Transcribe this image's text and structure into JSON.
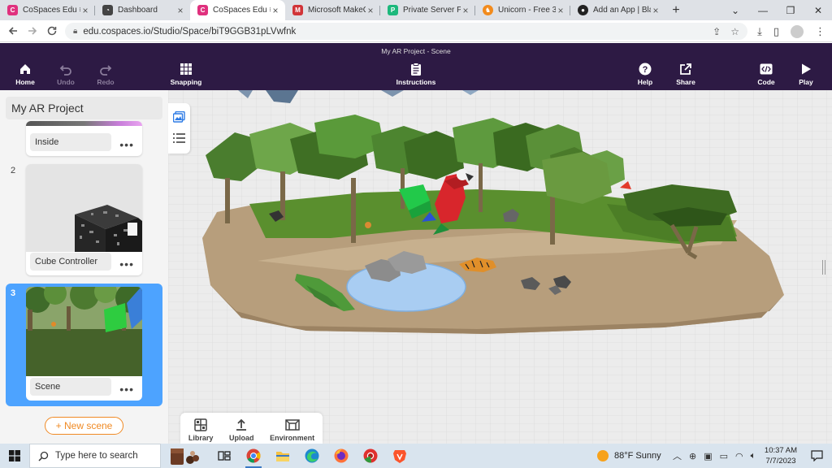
{
  "browser": {
    "tabs": [
      {
        "title": "CoSpaces Edu ≡ N",
        "favicon_color": "#e0317e",
        "favicon_glyph": "cospaces-icon",
        "active": false
      },
      {
        "title": "Dashboard",
        "favicon_color": "#444444",
        "favicon_glyph": "dashboard-icon",
        "active": false
      },
      {
        "title": "CoSpaces Edu ≡ N",
        "favicon_color": "#e0317e",
        "favicon_glyph": "cospaces-icon",
        "active": true
      },
      {
        "title": "Microsoft MakeC",
        "favicon_color": "#d13438",
        "favicon_glyph": "makecode-icon",
        "active": false
      },
      {
        "title": "Private Server Pa",
        "favicon_color": "#1db87c",
        "favicon_glyph": "pterodactyl-icon",
        "active": false
      },
      {
        "title": "Unicorn - Free 3D",
        "favicon_color": "#f28b1d",
        "favicon_glyph": "unicorn-icon",
        "active": false
      },
      {
        "title": "Add an App | Bla",
        "favicon_color": "#222222",
        "favicon_glyph": "blackbaud-icon",
        "active": false
      }
    ],
    "url": "edu.cospaces.io/Studio/Space/biT9GGB31pLVwfnk"
  },
  "app": {
    "doc_title": "My AR Project - Scene",
    "header_left": [
      {
        "label": "Home",
        "icon": "home-icon"
      },
      {
        "label": "Undo",
        "icon": "undo-icon",
        "disabled": true
      },
      {
        "label": "Redo",
        "icon": "redo-icon",
        "disabled": true
      },
      {
        "label": "Snapping",
        "icon": "grid-icon"
      }
    ],
    "instructions_label": "Instructions",
    "header_right": [
      {
        "label": "Help",
        "icon": "help-icon"
      },
      {
        "label": "Share",
        "icon": "share-icon"
      },
      {
        "label": "Code",
        "icon": "code-icon"
      },
      {
        "label": "Play",
        "icon": "play-icon"
      }
    ],
    "project_title": "My AR Project",
    "scenes": [
      {
        "number": "",
        "name": "Inside"
      },
      {
        "number": "2",
        "name": "Cube Controller"
      },
      {
        "number": "3",
        "name": "Scene",
        "selected": true
      }
    ],
    "new_scene_label": "+ New scene",
    "bottom_tools": [
      "Library",
      "Upload",
      "Environment"
    ]
  },
  "taskbar": {
    "search_placeholder": "Type here to search",
    "weather": "88°F  Sunny",
    "time": "10:37 AM",
    "date": "7/7/2023"
  },
  "colors": {
    "header_bg": "#2d1a44",
    "accent_orange": "#f08a24",
    "selected_blue": "#4da3ff"
  }
}
